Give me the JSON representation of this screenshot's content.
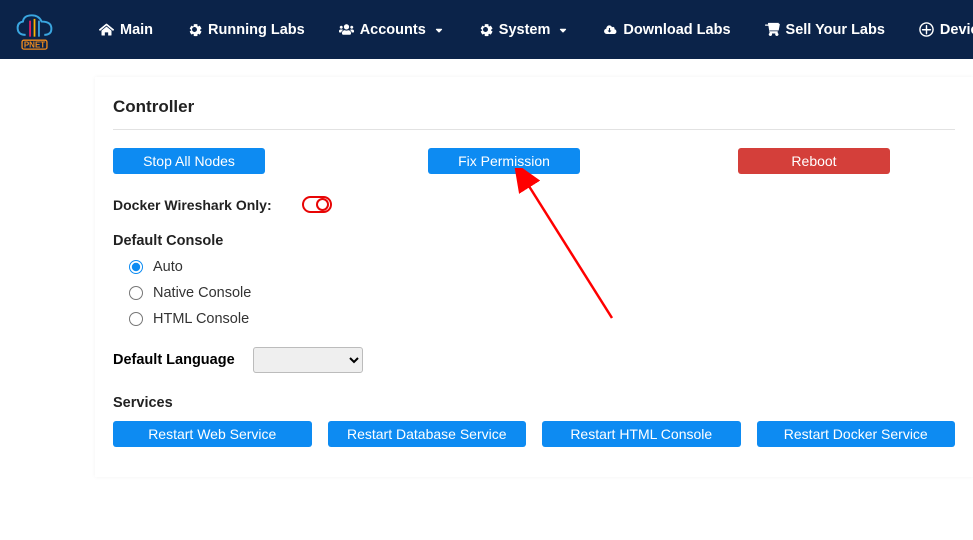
{
  "nav": {
    "main": "Main",
    "running_labs": "Running Labs",
    "accounts": "Accounts",
    "system": "System",
    "download_labs": "Download Labs",
    "sell_labs": "Sell Your Labs",
    "devices": "Devices"
  },
  "panel": {
    "title": "Controller",
    "stop_all_nodes": "Stop All Nodes",
    "fix_permission": "Fix Permission",
    "reboot": "Reboot",
    "docker_wireshark_label": "Docker Wireshark Only:",
    "default_console_label": "Default Console",
    "console_options": {
      "auto": "Auto",
      "native": "Native Console",
      "html": "HTML Console",
      "selected": "auto"
    },
    "default_language_label": "Default Language",
    "services_label": "Services",
    "restart_web": "Restart Web Service",
    "restart_db": "Restart Database Service",
    "restart_html": "Restart HTML Console",
    "restart_docker": "Restart Docker Service"
  },
  "colors": {
    "navbar_bg": "#0b2349",
    "btn_blue": "#0d8bf2",
    "btn_red": "#d43f3a",
    "toggle_red": "#e80505"
  }
}
